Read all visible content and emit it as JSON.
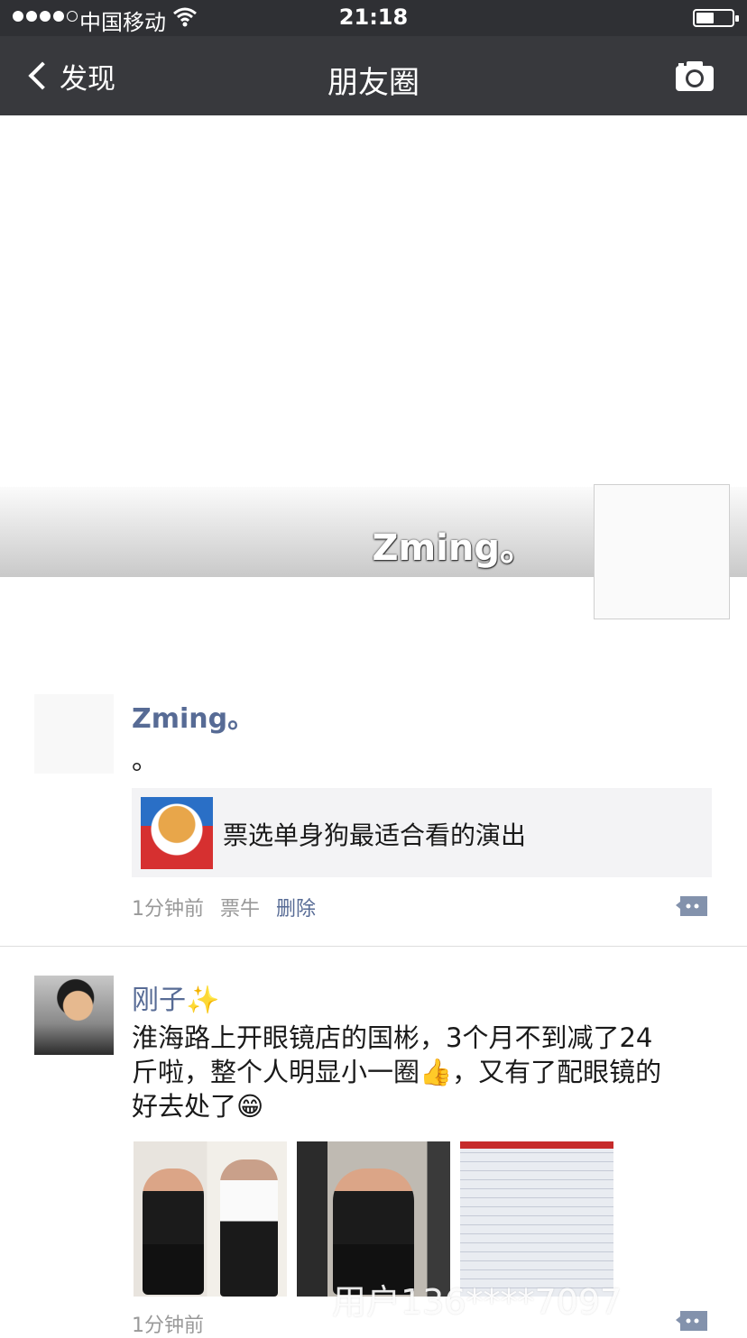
{
  "status_bar": {
    "carrier": "中国移动",
    "time": "21:18",
    "battery_level": 0.5
  },
  "nav": {
    "back_label": "发现",
    "title": "朋友圈"
  },
  "profile": {
    "name": "Zming。"
  },
  "moments": [
    {
      "author": "Zming。",
      "text": "。",
      "link_title": "票选单身狗最适合看的演出",
      "time": "1分钟前",
      "source": "票牛",
      "delete_label": "删除"
    },
    {
      "author": "刚子✨",
      "text_line1": "淮海路上开眼镜店的国彬，3个月不到减了24",
      "text_line2": "斤啦，整个人明显小一圈👍，又有了配眼镜的",
      "text_line3": "好去处了😁",
      "time": "1分钟前"
    }
  ],
  "watermark": "用户136****7097",
  "colors": {
    "nav_bg": "#38393d",
    "status_bg": "#2f3034",
    "link_blue": "#576b95"
  }
}
